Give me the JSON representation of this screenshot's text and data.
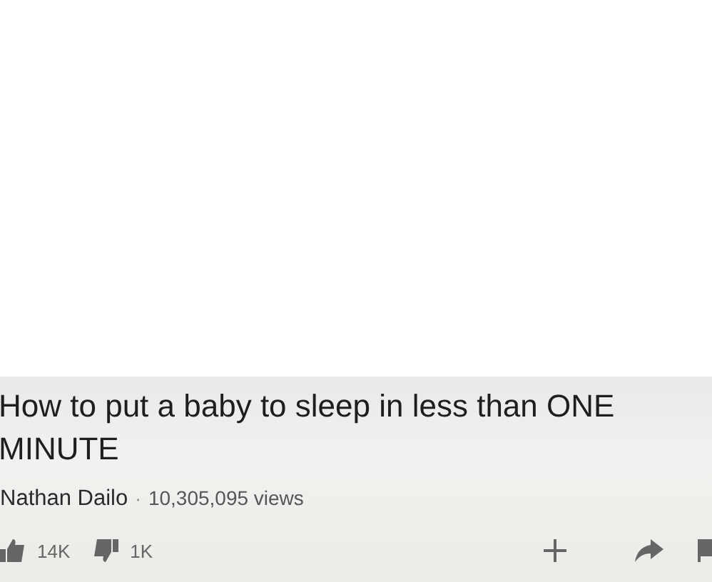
{
  "video": {
    "title": "How to put a baby to sleep in less than ONE MINUTE",
    "channel": "Nathan Dailo",
    "separator": "·",
    "views": "10,305,095 views"
  },
  "actions": {
    "likes": "14K",
    "dislikes": "1K"
  }
}
